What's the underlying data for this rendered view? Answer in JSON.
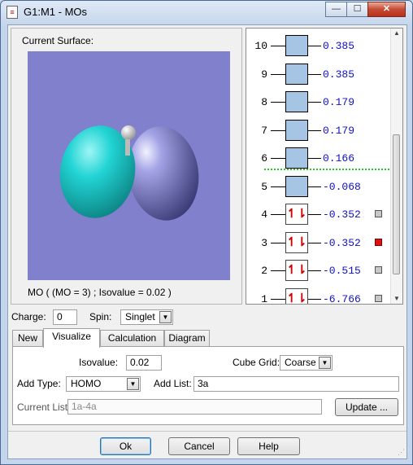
{
  "window": {
    "title": "G1:M1 - MOs",
    "min_glyph": "—",
    "max_glyph": "☐",
    "close_glyph": "✕"
  },
  "surface": {
    "label": "Current Surface:",
    "caption": "MO ( (MO = 3) ; Isovalue = 0.02 )"
  },
  "orbitals": [
    {
      "num": "10",
      "energy": "0.385",
      "occupied": false,
      "selected": null
    },
    {
      "num": "9",
      "energy": "0.385",
      "occupied": false,
      "selected": null
    },
    {
      "num": "8",
      "energy": "0.179",
      "occupied": false,
      "selected": null
    },
    {
      "num": "7",
      "energy": "0.179",
      "occupied": false,
      "selected": null
    },
    {
      "num": "6",
      "energy": "0.166",
      "occupied": false,
      "selected": null
    },
    {
      "num": "5",
      "energy": "-0.068",
      "occupied": false,
      "selected": null
    },
    {
      "num": "4",
      "energy": "-0.352",
      "occupied": true,
      "selected": false
    },
    {
      "num": "3",
      "energy": "-0.352",
      "occupied": true,
      "selected": true
    },
    {
      "num": "2",
      "energy": "-0.515",
      "occupied": true,
      "selected": false
    },
    {
      "num": "1",
      "energy": "-6.766",
      "occupied": true,
      "selected": false
    }
  ],
  "occupancy_glyph": "↿⇂",
  "charge": {
    "label": "Charge:",
    "value": "0"
  },
  "spin": {
    "label": "Spin:",
    "value": "Singlet"
  },
  "tabs": [
    "New",
    "Visualize",
    "Calculation",
    "Diagram"
  ],
  "visualize": {
    "isovalue_label": "Isovalue:",
    "isovalue": "0.02",
    "cube_grid_label": "Cube Grid:",
    "cube_grid": "Coarse",
    "add_type_label": "Add Type:",
    "add_type": "HOMO",
    "add_list_label": "Add List:",
    "add_list": "3a",
    "current_list_label": "Current List:",
    "current_list": "1a-4a",
    "update_label": "Update ..."
  },
  "buttons": {
    "ok": "Ok",
    "cancel": "Cancel",
    "help": "Help"
  },
  "colors": {
    "viewport": "#8080cc",
    "lobe_positive": "#20c8c8",
    "lobe_negative": "#8a8ad8",
    "energy_text": "#1010c8",
    "selected": "#dd1111",
    "homo_lumo_gap": "#22cc22"
  }
}
